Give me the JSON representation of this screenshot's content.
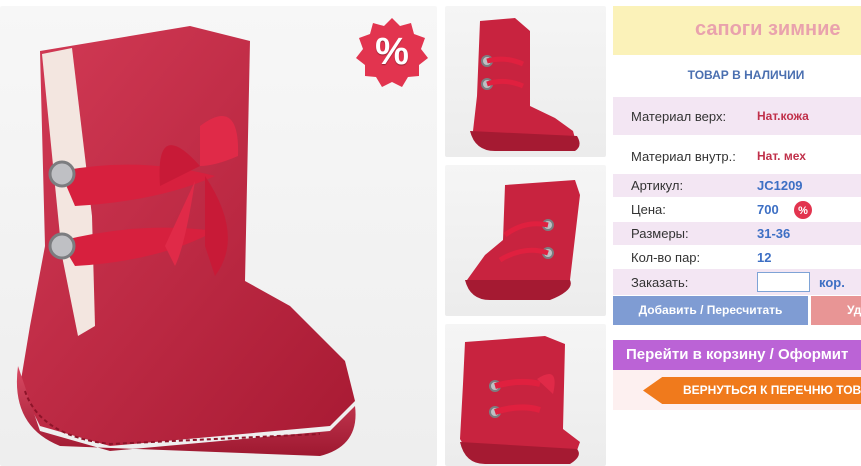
{
  "product": {
    "title": "сапоги зимние",
    "stock_status": "ТОВАР В НАЛИЧИИ"
  },
  "sale_badge": {
    "label": "%"
  },
  "details": [
    {
      "label": "Материал верх:",
      "value": "Нат.кожа"
    },
    {
      "label": "Материал внутр.:",
      "value": "Нат. мех"
    },
    {
      "label": "Артикул:",
      "value": "JC1209"
    },
    {
      "label": "Цена:",
      "value": "700"
    },
    {
      "label": "Размеры:",
      "value": "31-36"
    },
    {
      "label": "Кол-во пар:",
      "value": "12"
    }
  ],
  "order": {
    "label": "Заказать:",
    "quantity_value": "",
    "unit": "кор."
  },
  "buttons": {
    "add_recalc": "Добавить / Пересчитать",
    "delete": "Уд",
    "go_to_cart": "Перейти в корзину / Оформит",
    "back_to_list": "ВЕРНУТЬСЯ К ПЕРЕЧНЮ ТОВАР"
  },
  "colors": {
    "boot": "#c8233f",
    "title_bg": "#fbf2b9",
    "accent_blue": "#3d6fc4",
    "accent_purple": "#bb63d6",
    "accent_orange": "#f07a1c"
  },
  "icons": [
    "percent-badge-icon",
    "ribbon-bow-icon",
    "rhinestone-button-icon"
  ]
}
